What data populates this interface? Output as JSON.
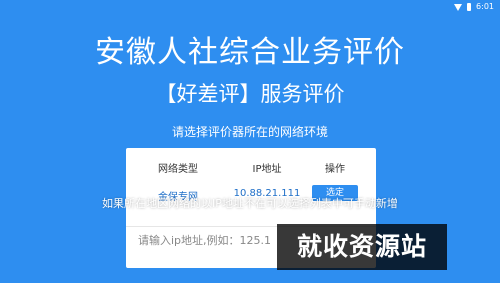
{
  "status_bar": {
    "time": "6:01",
    "icons": [
      "wifi-icon",
      "battery-icon"
    ]
  },
  "header": {
    "title": "安徽人社综合业务评价",
    "subtitle": "【好差评】服务评价"
  },
  "prompt": "请选择评价器所在的网络环境",
  "network_table": {
    "columns": [
      "网络类型",
      "IP地址",
      "操作"
    ],
    "rows": [
      {
        "type": "金保专网",
        "ip": "10.88.21.111",
        "action": "选定"
      }
    ]
  },
  "ip_input": {
    "placeholder": "请输入ip地址,例如：125.1"
  },
  "hint": "如果所在地区网络的以IP地址不在可以选择列表中可手动新增",
  "watermark": "就收资源站",
  "colors": {
    "background": "#2e8ef0",
    "accent_text": "#1f6fc8"
  }
}
